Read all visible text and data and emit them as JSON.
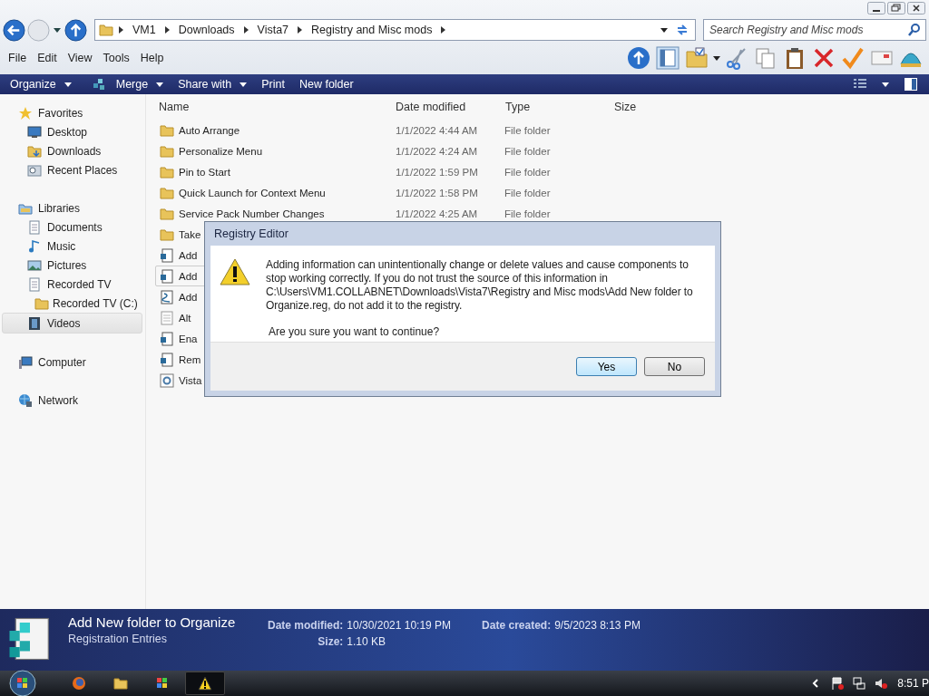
{
  "address": {
    "breadcrumbs": [
      "VM1",
      "Downloads",
      "Vista7",
      "Registry and Misc mods"
    ]
  },
  "search": {
    "placeholder": "Search Registry and Misc mods"
  },
  "menu": [
    "File",
    "Edit",
    "View",
    "Tools",
    "Help"
  ],
  "command_bar": [
    {
      "label": "Organize",
      "dropdown": true,
      "kind": "plain"
    },
    {
      "label": "Merge",
      "dropdown": true,
      "kind": "merge"
    },
    {
      "label": "Share with",
      "dropdown": true,
      "kind": "plain"
    },
    {
      "label": "Print",
      "dropdown": false,
      "kind": "plain"
    },
    {
      "label": "New folder",
      "dropdown": false,
      "kind": "plain"
    }
  ],
  "sidebar": [
    {
      "label": "Favorites",
      "kind": "star",
      "children": [
        {
          "label": "Desktop",
          "kind": "desktop",
          "selected": false
        },
        {
          "label": "Downloads",
          "kind": "downloads",
          "selected": false
        },
        {
          "label": "Recent Places",
          "kind": "recent",
          "selected": false
        }
      ]
    },
    {
      "label": "Libraries",
      "kind": "library",
      "children": [
        {
          "label": "Documents",
          "kind": "document",
          "selected": false
        },
        {
          "label": "Music",
          "kind": "music",
          "selected": false
        },
        {
          "label": "Pictures",
          "kind": "pictures",
          "selected": false
        },
        {
          "label": "Recorded TV",
          "kind": "document",
          "selected": false,
          "children": [
            {
              "label": "Recorded TV (C:)",
              "kind": "folder",
              "selected": false
            }
          ]
        },
        {
          "label": "Videos",
          "kind": "video",
          "selected": true
        }
      ]
    },
    {
      "label": "Computer",
      "kind": "computer"
    },
    {
      "label": "Network",
      "kind": "network"
    }
  ],
  "table": {
    "columns": [
      "Name",
      "Date modified",
      "Type",
      "Size"
    ],
    "rows": [
      {
        "kind": "folder",
        "name": "Auto Arrange",
        "date": "1/1/2022 4:44 AM",
        "type": "File folder",
        "selected": false
      },
      {
        "kind": "folder",
        "name": "Personalize Menu",
        "date": "1/1/2022 4:24 AM",
        "type": "File folder",
        "selected": false
      },
      {
        "kind": "folder",
        "name": "Pin to Start",
        "date": "1/1/2022 1:59 PM",
        "type": "File folder",
        "selected": false
      },
      {
        "kind": "folder",
        "name": "Quick Launch for Context Menu",
        "date": "1/1/2022 1:58 PM",
        "type": "File folder",
        "selected": false
      },
      {
        "kind": "folder",
        "name": "Service Pack Number Changes",
        "date": "1/1/2022 4:25 AM",
        "type": "File folder",
        "selected": false
      },
      {
        "kind": "folder",
        "name": "Take",
        "selected": false
      },
      {
        "kind": "reg",
        "name": "Add",
        "selected": false
      },
      {
        "kind": "reg",
        "name": "Add",
        "selected": true
      },
      {
        "kind": "script",
        "name": "Add",
        "selected": false
      },
      {
        "kind": "text",
        "name": "Alt",
        "selected": false
      },
      {
        "kind": "reg",
        "name": "Ena",
        "selected": false
      },
      {
        "kind": "reg",
        "name": "Rem",
        "selected": false
      },
      {
        "kind": "settings",
        "name": "Vista",
        "selected": false
      }
    ]
  },
  "dialog": {
    "title": "Registry Editor",
    "message": "Adding information can unintentionally change or delete values and cause components to stop working correctly. If you do not trust the source of this information in C:\\Users\\VM1.COLLABNET\\Downloads\\Vista7\\Registry and Misc mods\\Add New folder to Organize.reg, do not add it to the registry.",
    "question": "Are you sure you want to continue?",
    "buttons": [
      {
        "label": "Yes",
        "default": true
      },
      {
        "label": "No",
        "default": false
      }
    ]
  },
  "details": {
    "name": "Add New folder to Organize",
    "type": "Registration Entries",
    "fields": [
      {
        "label": "Date modified:",
        "value": "10/30/2021 10:19 PM"
      },
      {
        "label": "Date created:",
        "value": "9/5/2023 8:13 PM"
      },
      {
        "label": "Size:",
        "value": "1.10 KB"
      }
    ]
  },
  "taskbar": {
    "apps": [
      {
        "kind": "firefox",
        "active": false
      },
      {
        "kind": "explorer",
        "active": false
      },
      {
        "kind": "windows",
        "active": false
      },
      {
        "kind": "warning",
        "active": true
      }
    ],
    "clock": "8:51 P"
  }
}
